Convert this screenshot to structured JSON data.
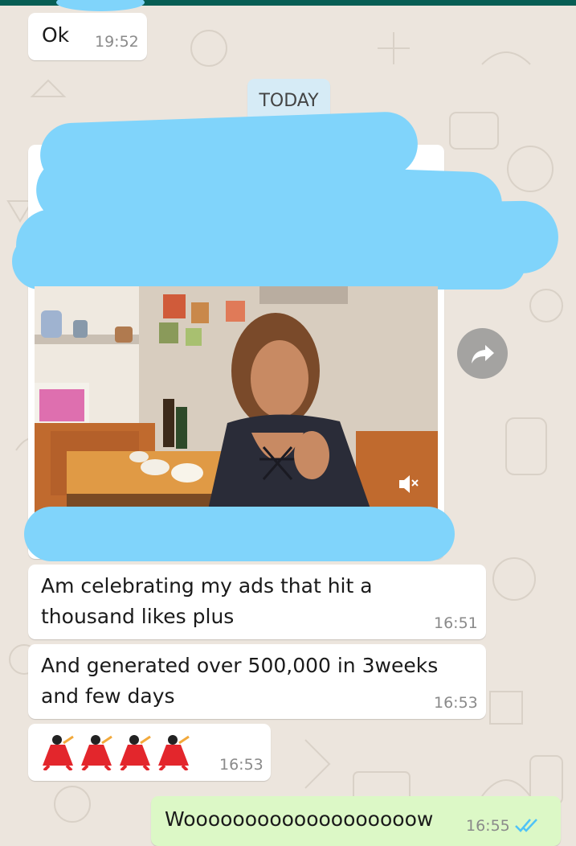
{
  "chat": {
    "messages": [
      {
        "text": "Ok",
        "time": "19:52"
      },
      {
        "text": "Am celebrating my ads that hit a",
        "text2": "thousand likes plus",
        "time": "16:51"
      },
      {
        "text": "And generated over 500,000 in 3weeks",
        "text2": "and few days",
        "time": "16:53"
      },
      {
        "emoji": "dancer-emoji",
        "count": 4,
        "time": "16:53"
      },
      {
        "text": "Wooooooooooooooooooow",
        "time": "16:55",
        "status": "read"
      }
    ],
    "date_divider": "TODAY"
  },
  "media": {
    "video_muted_icon": "speaker-muted-icon",
    "forward_icon": "forward-arrow-icon"
  },
  "colors": {
    "chat_bg": "#ece5dd",
    "incoming_bubble": "#ffffff",
    "outgoing_bubble": "#dcf8c6",
    "redaction": "#80d4fb",
    "read_ticks": "#4fc3f7",
    "date_chip": "#d6ebf6"
  }
}
